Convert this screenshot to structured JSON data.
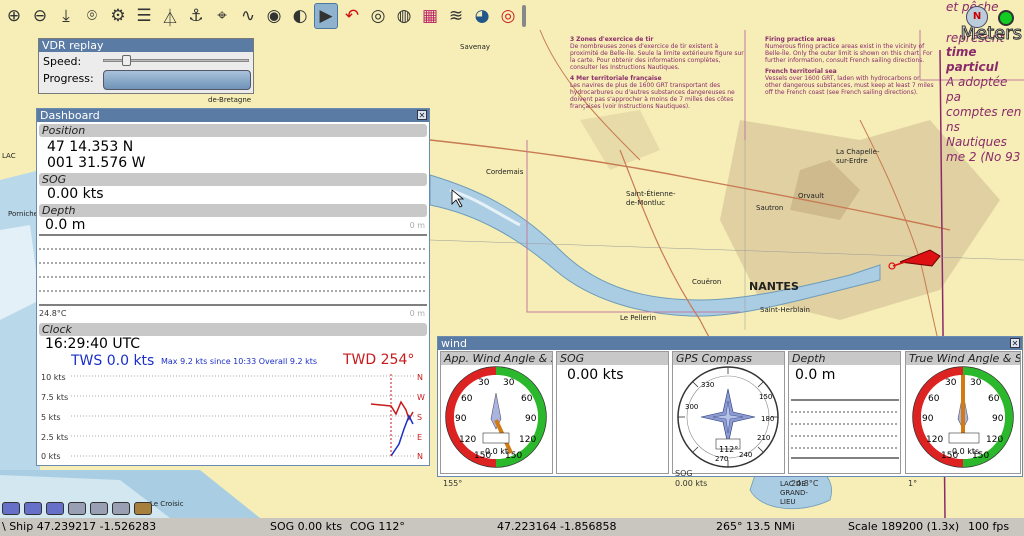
{
  "toolbar": {
    "icons": [
      "zoom-in-icon",
      "zoom-out-icon",
      "north-up-icon",
      "route-icon",
      "settings-icon",
      "list-icon",
      "ais-icon",
      "anchor-icon",
      "waypoint-icon",
      "track-icon",
      "compass-icon",
      "select-icon",
      "mob-icon",
      "record-icon",
      "play-icon",
      "tide-icon",
      "weather-icon",
      "globe-icon",
      "lifebuoy-icon"
    ]
  },
  "vdr": {
    "title": "VDR replay",
    "speed_label": "Speed:",
    "progress_label": "Progress:"
  },
  "dashboard": {
    "title": "Dashboard",
    "position_label": "Position",
    "lat": "47 14.353 N",
    "lon": "001 31.576 W",
    "sog_label": "SOG",
    "sog": "0.00 kts",
    "depth_label": "Depth",
    "depth": "0.0 m",
    "depth_unit": "0 m",
    "temp": "24.8°C",
    "clock_label": "Clock",
    "clock": "16:29:40 UTC",
    "tws": "TWS 0.0 kts",
    "tws_max": "Max 9.2 kts since 10:33  Overall 9.2 kts",
    "twd": "TWD 254°",
    "tws_ticks": [
      "10 kts",
      "7.5 kts",
      "5 kts",
      "2.5 kts",
      "0 kts"
    ],
    "dir_ticks": [
      "N",
      "W",
      "S",
      "E",
      "N"
    ]
  },
  "wind": {
    "title": "wind",
    "cells": [
      {
        "label": "App. Wind Angle & Speed",
        "speed": "0.0 kt",
        "corner": "155°"
      },
      {
        "label": "SOG",
        "value": "0.00 kts"
      },
      {
        "label": "GPS Compass",
        "heading": "112°",
        "sog_label": "SOG",
        "sog": "0.00 kts"
      },
      {
        "label": "Depth",
        "value": "0.0 m",
        "temp": "24.8°C"
      },
      {
        "label": "True Wind Angle & Speed",
        "speed": "0.0 kts",
        "corner": "1°"
      }
    ]
  },
  "map": {
    "place_labels": [
      "Savenay",
      "de-Bretagne",
      "Cordemais",
      "Saint-Étienne-de-Montluc",
      "Sautron",
      "Orvault",
      "La Chapelle-sur-Erdre",
      "NANTES",
      "Couëron",
      "Le Pellerin",
      "Saint-Herblain",
      "LAC DE GRAND-LIEU",
      "LAC",
      "Pornichet",
      "Le Croisic"
    ],
    "notes": [
      {
        "num": "3",
        "heading": "Zones d'exercice de tir",
        "body": "De nombreuses zones d'exercice de tir existent à proximité de Belle-Île. Seule la limite extérieure figure sur la carte. Pour obtenir des informations complètes, consulter les Instructions Nautiques."
      },
      {
        "num": "4",
        "heading": "Mer territoriale française",
        "body": "Les navires de plus de 1600 GRT transportant des hydrocarbures ou d'autres substances dangereuses ne doivent pas s'approcher à moins de 7 milles des côtes françaises (voir Instructions Nautiques)."
      },
      {
        "heading": "Firing practice areas",
        "body": "Numerous firing practice areas exist in the vicinity of Belle-Île. Only the outer limit is shown on this chart. For further information, consult French sailing directions."
      },
      {
        "heading": "French territorial sea",
        "body": "Vessels over 1600 GRT, laden with hydrocarbons or other dangerous substances, must keep at least 7 miles off the French coast (see French sailing directions)."
      }
    ],
    "right_text": [
      "et pêche",
      "représent",
      "Meters",
      "time particul",
      "A adoptée pa",
      "comptes ren",
      "ns Nautiques",
      "me 2 (No 93"
    ],
    "north_arrow": "N"
  },
  "statusbar": {
    "ship": "\\ Ship 47.239217   -1.526283",
    "sog": "SOG 0.00 kts",
    "cog": "COG 112°",
    "cursor": "47.223164   -1.856858",
    "bearing": "265°  13.5 NMi",
    "scale": "Scale 189200 (1.3x)",
    "fps": "100 fps"
  }
}
